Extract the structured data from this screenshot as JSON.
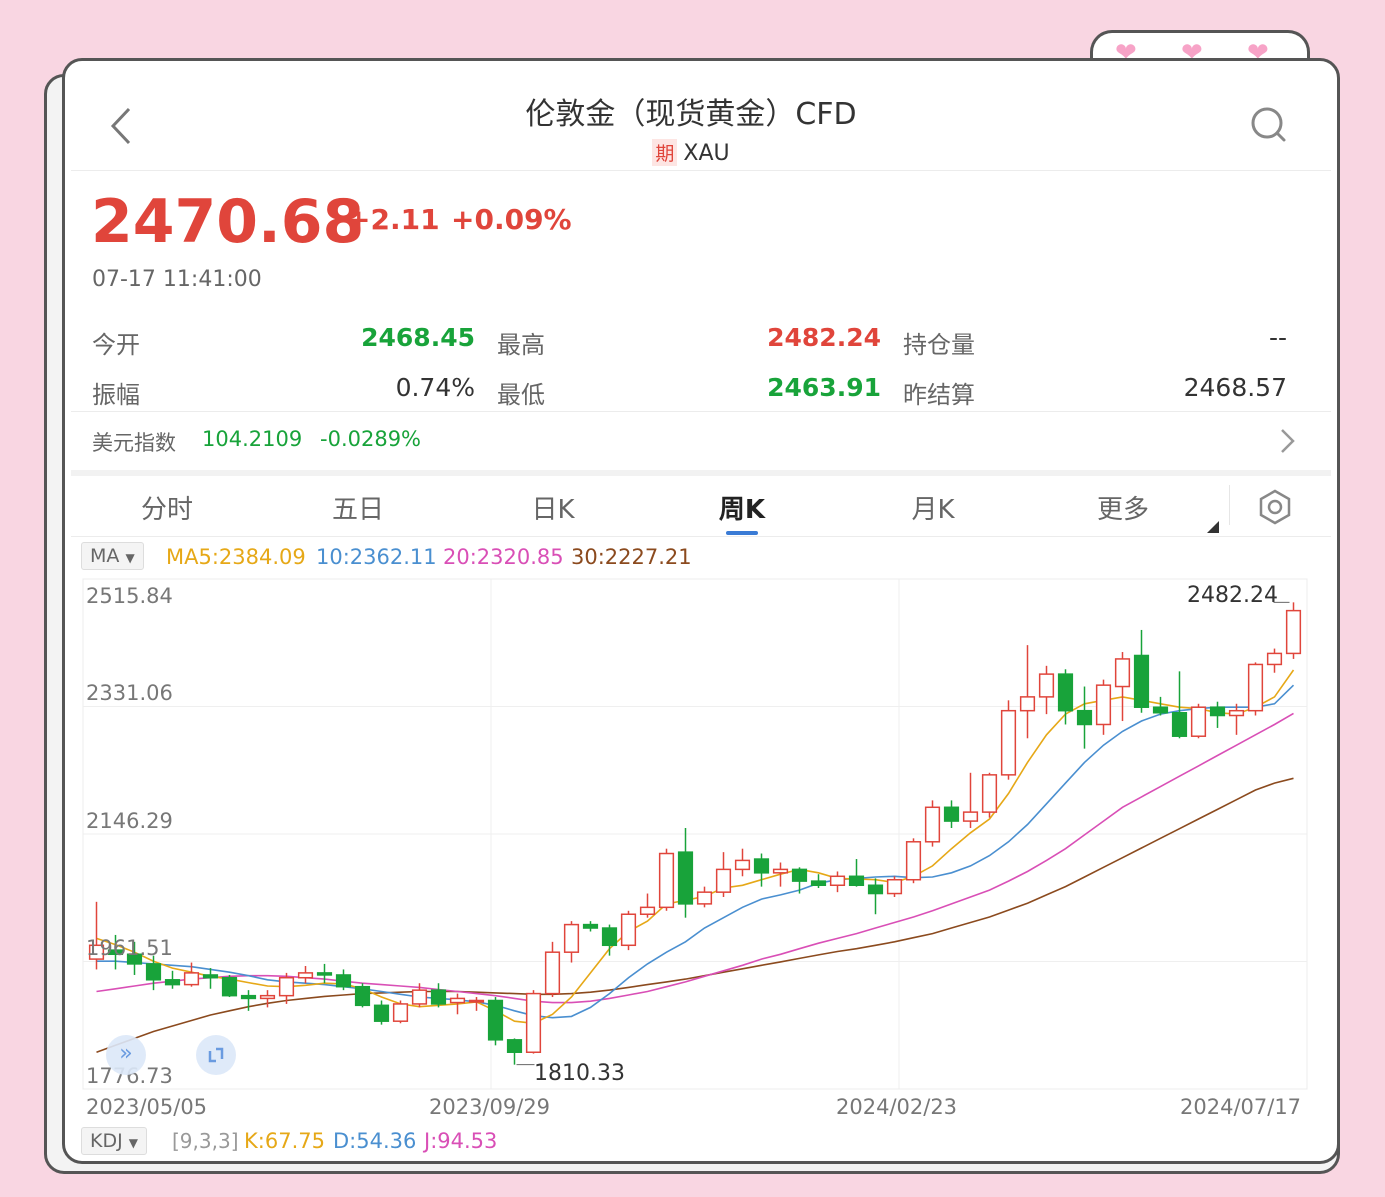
{
  "header": {
    "title": "伦敦金（现货黄金）CFD",
    "badge": "期",
    "symbol": "XAU"
  },
  "quote": {
    "price": "2470.68",
    "change": "+2.11",
    "change_pct": "+0.09%",
    "time": "07-17 11:41:00"
  },
  "stats": {
    "open_label": "今开",
    "open": "2468.45",
    "high_label": "最高",
    "high": "2482.24",
    "oi_label": "持仓量",
    "oi": "--",
    "amp_label": "振幅",
    "amp": "0.74%",
    "low_label": "最低",
    "low": "2463.91",
    "settle_label": "昨结算",
    "settle": "2468.57"
  },
  "dxy": {
    "label": "美元指数",
    "value": "104.2109",
    "change": "-0.0289%"
  },
  "tabs": [
    "分时",
    "五日",
    "日K",
    "周K",
    "月K",
    "更多"
  ],
  "active_tab": 3,
  "ma": {
    "selector": "MA",
    "ma5": "MA5:2384.09",
    "ma10": "10:2362.11",
    "ma20": "20:2320.85",
    "ma30": "30:2227.21"
  },
  "kdj": {
    "selector": "KDJ",
    "params": "[9,3,3]",
    "k": "K:67.75",
    "d": "D:54.36",
    "j": "J:94.53"
  },
  "colors": {
    "up": "#e0453b",
    "down": "#18a33a",
    "ma5": "#e6a817",
    "ma10": "#4a8fd0",
    "ma20": "#d94fb6",
    "ma30": "#8b4a1e",
    "accent": "#3a7bd5"
  },
  "chart_data": {
    "type": "candlestick",
    "y_labels": [
      "2515.84",
      "2331.06",
      "2146.29",
      "1961.51",
      "1776.73"
    ],
    "x_labels": [
      "2023/05/05",
      "2023/09/29",
      "2024/02/23",
      "2024/07/17"
    ],
    "ylim": [
      1776.73,
      2515.84
    ],
    "max_label": "2482.24",
    "min_label": "1810.33",
    "candles": [
      {
        "o": 1965,
        "h": 2048,
        "l": 1950,
        "c": 1985
      },
      {
        "o": 1978,
        "h": 2000,
        "l": 1950,
        "c": 1972
      },
      {
        "o": 1972,
        "h": 1990,
        "l": 1942,
        "c": 1958
      },
      {
        "o": 1958,
        "h": 1970,
        "l": 1920,
        "c": 1935
      },
      {
        "o": 1935,
        "h": 1948,
        "l": 1922,
        "c": 1928
      },
      {
        "o": 1928,
        "h": 1960,
        "l": 1925,
        "c": 1945
      },
      {
        "o": 1942,
        "h": 1952,
        "l": 1922,
        "c": 1938
      },
      {
        "o": 1938,
        "h": 1942,
        "l": 1910,
        "c": 1912
      },
      {
        "o": 1912,
        "h": 1920,
        "l": 1890,
        "c": 1908
      },
      {
        "o": 1908,
        "h": 1920,
        "l": 1895,
        "c": 1912
      },
      {
        "o": 1912,
        "h": 1945,
        "l": 1900,
        "c": 1938
      },
      {
        "o": 1938,
        "h": 1955,
        "l": 1930,
        "c": 1945
      },
      {
        "o": 1945,
        "h": 1958,
        "l": 1930,
        "c": 1942
      },
      {
        "o": 1942,
        "h": 1950,
        "l": 1920,
        "c": 1925
      },
      {
        "o": 1925,
        "h": 1930,
        "l": 1895,
        "c": 1898
      },
      {
        "o": 1898,
        "h": 1905,
        "l": 1870,
        "c": 1875
      },
      {
        "o": 1875,
        "h": 1905,
        "l": 1872,
        "c": 1900
      },
      {
        "o": 1900,
        "h": 1930,
        "l": 1895,
        "c": 1920
      },
      {
        "o": 1920,
        "h": 1930,
        "l": 1895,
        "c": 1900
      },
      {
        "o": 1902,
        "h": 1915,
        "l": 1885,
        "c": 1908
      },
      {
        "o": 1905,
        "h": 1910,
        "l": 1890,
        "c": 1905
      },
      {
        "o": 1905,
        "h": 1910,
        "l": 1840,
        "c": 1848
      },
      {
        "o": 1848,
        "h": 1850,
        "l": 1812,
        "c": 1830
      },
      {
        "o": 1830,
        "h": 1920,
        "l": 1828,
        "c": 1915
      },
      {
        "o": 1915,
        "h": 1990,
        "l": 1910,
        "c": 1975
      },
      {
        "o": 1975,
        "h": 2020,
        "l": 1960,
        "c": 2015
      },
      {
        "o": 2015,
        "h": 2020,
        "l": 2005,
        "c": 2010
      },
      {
        "o": 2010,
        "h": 2015,
        "l": 1970,
        "c": 1985
      },
      {
        "o": 1985,
        "h": 2035,
        "l": 1978,
        "c": 2030
      },
      {
        "o": 2030,
        "h": 2060,
        "l": 2025,
        "c": 2040
      },
      {
        "o": 2040,
        "h": 2125,
        "l": 2035,
        "c": 2118
      },
      {
        "o": 2120,
        "h": 2155,
        "l": 2025,
        "c": 2045
      },
      {
        "o": 2045,
        "h": 2070,
        "l": 2040,
        "c": 2062
      },
      {
        "o": 2062,
        "h": 2120,
        "l": 2055,
        "c": 2095
      },
      {
        "o": 2095,
        "h": 2125,
        "l": 2085,
        "c": 2108
      },
      {
        "o": 2110,
        "h": 2118,
        "l": 2070,
        "c": 2090
      },
      {
        "o": 2090,
        "h": 2105,
        "l": 2070,
        "c": 2095
      },
      {
        "o": 2095,
        "h": 2098,
        "l": 2060,
        "c": 2078
      },
      {
        "o": 2078,
        "h": 2088,
        "l": 2068,
        "c": 2072
      },
      {
        "o": 2072,
        "h": 2092,
        "l": 2062,
        "c": 2085
      },
      {
        "o": 2085,
        "h": 2110,
        "l": 2070,
        "c": 2072
      },
      {
        "o": 2072,
        "h": 2082,
        "l": 2030,
        "c": 2060
      },
      {
        "o": 2060,
        "h": 2085,
        "l": 2055,
        "c": 2080
      },
      {
        "o": 2080,
        "h": 2140,
        "l": 2075,
        "c": 2135
      },
      {
        "o": 2135,
        "h": 2195,
        "l": 2128,
        "c": 2185
      },
      {
        "o": 2185,
        "h": 2195,
        "l": 2155,
        "c": 2165
      },
      {
        "o": 2165,
        "h": 2235,
        "l": 2155,
        "c": 2178
      },
      {
        "o": 2178,
        "h": 2235,
        "l": 2170,
        "c": 2232
      },
      {
        "o": 2232,
        "h": 2340,
        "l": 2225,
        "c": 2325
      },
      {
        "o": 2325,
        "h": 2420,
        "l": 2285,
        "c": 2345
      },
      {
        "o": 2345,
        "h": 2390,
        "l": 2320,
        "c": 2378
      },
      {
        "o": 2378,
        "h": 2385,
        "l": 2305,
        "c": 2325
      },
      {
        "o": 2325,
        "h": 2360,
        "l": 2270,
        "c": 2305
      },
      {
        "o": 2305,
        "h": 2370,
        "l": 2290,
        "c": 2362
      },
      {
        "o": 2360,
        "h": 2410,
        "l": 2310,
        "c": 2400
      },
      {
        "o": 2405,
        "h": 2442,
        "l": 2322,
        "c": 2330
      },
      {
        "o": 2330,
        "h": 2345,
        "l": 2318,
        "c": 2322
      },
      {
        "o": 2322,
        "h": 2382,
        "l": 2285,
        "c": 2288
      },
      {
        "o": 2288,
        "h": 2335,
        "l": 2285,
        "c": 2330
      },
      {
        "o": 2330,
        "h": 2338,
        "l": 2300,
        "c": 2318
      },
      {
        "o": 2318,
        "h": 2335,
        "l": 2290,
        "c": 2325
      },
      {
        "o": 2325,
        "h": 2395,
        "l": 2318,
        "c": 2392
      },
      {
        "o": 2392,
        "h": 2415,
        "l": 2380,
        "c": 2408
      },
      {
        "o": 2408,
        "h": 2482,
        "l": 2400,
        "c": 2470
      }
    ],
    "ma5": [
      1995,
      1986,
      1975,
      1962,
      1952,
      1946,
      1940,
      1936,
      1931,
      1926,
      1925,
      1927,
      1930,
      1929,
      1922,
      1910,
      1900,
      1896,
      1898,
      1900,
      1903,
      1890,
      1875,
      1872,
      1885,
      1910,
      1945,
      1980,
      2005,
      2020,
      2045,
      2050,
      2056,
      2068,
      2072,
      2080,
      2088,
      2095,
      2090,
      2082,
      2081,
      2080,
      2076,
      2085,
      2100,
      2125,
      2148,
      2168,
      2205,
      2250,
      2290,
      2320,
      2335,
      2340,
      2345,
      2340,
      2335,
      2330,
      2328,
      2322,
      2320,
      2330,
      2345,
      2384
    ],
    "ma10": [
      1962,
      1962,
      1960,
      1958,
      1956,
      1954,
      1950,
      1946,
      1941,
      1935,
      1932,
      1930,
      1928,
      1925,
      1922,
      1918,
      1914,
      1910,
      1908,
      1906,
      1903,
      1898,
      1890,
      1883,
      1880,
      1882,
      1895,
      1915,
      1938,
      1958,
      1975,
      1990,
      2010,
      2025,
      2040,
      2052,
      2058,
      2065,
      2075,
      2080,
      2082,
      2084,
      2085,
      2083,
      2084,
      2090,
      2100,
      2115,
      2135,
      2160,
      2190,
      2220,
      2250,
      2275,
      2295,
      2310,
      2320,
      2325,
      2328,
      2330,
      2330,
      2330,
      2335,
      2362
    ],
    "ma20": [
      1918,
      1922,
      1926,
      1930,
      1933,
      1936,
      1938,
      1940,
      1941,
      1941,
      1940,
      1938,
      1936,
      1933,
      1930,
      1928,
      1926,
      1924,
      1921,
      1918,
      1915,
      1912,
      1908,
      1904,
      1902,
      1902,
      1904,
      1908,
      1913,
      1918,
      1925,
      1932,
      1940,
      1948,
      1956,
      1965,
      1972,
      1980,
      1988,
      1995,
      2002,
      2010,
      2018,
      2026,
      2035,
      2045,
      2055,
      2065,
      2078,
      2092,
      2108,
      2125,
      2145,
      2165,
      2185,
      2200,
      2215,
      2230,
      2245,
      2260,
      2275,
      2290,
      2305,
      2321
    ],
    "ma30": [
      1830,
      1840,
      1850,
      1860,
      1868,
      1876,
      1884,
      1890,
      1896,
      1901,
      1905,
      1908,
      1911,
      1913,
      1915,
      1916,
      1917,
      1918,
      1918,
      1918,
      1917,
      1916,
      1915,
      1914,
      1914,
      1915,
      1917,
      1920,
      1924,
      1928,
      1932,
      1936,
      1941,
      1946,
      1951,
      1956,
      1961,
      1966,
      1971,
      1976,
      1980,
      1985,
      1990,
      1996,
      2002,
      2010,
      2018,
      2026,
      2036,
      2046,
      2058,
      2070,
      2084,
      2098,
      2112,
      2126,
      2140,
      2154,
      2168,
      2182,
      2196,
      2210,
      2220,
      2227
    ]
  }
}
